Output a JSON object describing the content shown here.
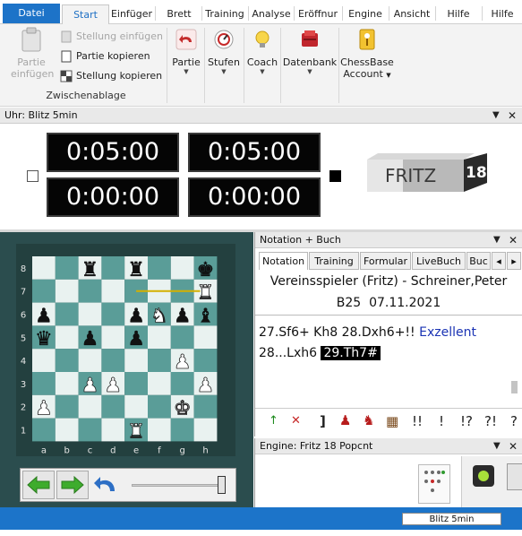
{
  "tabs": [
    "Datei",
    "Start",
    "Einfüger",
    "Brett",
    "Training",
    "Analyse",
    "Eröffnur",
    "Engine",
    "Ansicht",
    "Hilfe",
    "Hilfe"
  ],
  "ribbon": {
    "paste_label_1": "Partie",
    "paste_label_2": "einfügen",
    "insert_position": "Stellung einfügen",
    "copy_game": "Partie kopieren",
    "copy_position": "Stellung kopieren",
    "group_label": "Zwischenablage",
    "partie": "Partie",
    "stufen": "Stufen",
    "coach": "Coach",
    "datenbank": "Datenbank",
    "chessbase_1": "ChessBase",
    "chessbase_2": "Account"
  },
  "clock_panel": {
    "title": "Uhr: Blitz 5min",
    "times": [
      "0:05:00",
      "0:05:00",
      "0:00:00",
      "0:00:00"
    ],
    "logo_text": "FRITZ",
    "logo_number": "18"
  },
  "board": {
    "files": [
      "a",
      "b",
      "c",
      "d",
      "e",
      "f",
      "g",
      "h"
    ],
    "ranks": [
      "8",
      "7",
      "6",
      "5",
      "4",
      "3",
      "2",
      "1"
    ],
    "pieces": [
      {
        "sq": "c8",
        "p": "♜",
        "c": "b"
      },
      {
        "sq": "e8",
        "p": "♜",
        "c": "b"
      },
      {
        "sq": "h8",
        "p": "♚",
        "c": "b"
      },
      {
        "sq": "h7",
        "p": "♜",
        "c": "w"
      },
      {
        "sq": "a6",
        "p": "♟",
        "c": "b"
      },
      {
        "sq": "e6",
        "p": "♟",
        "c": "b"
      },
      {
        "sq": "f6",
        "p": "♞",
        "c": "w"
      },
      {
        "sq": "g6",
        "p": "♟",
        "c": "b"
      },
      {
        "sq": "h6",
        "p": "♝",
        "c": "b"
      },
      {
        "sq": "a5",
        "p": "♛",
        "c": "b"
      },
      {
        "sq": "c5",
        "p": "♟",
        "c": "b"
      },
      {
        "sq": "e5",
        "p": "♟",
        "c": "b"
      },
      {
        "sq": "g4",
        "p": "♟",
        "c": "w"
      },
      {
        "sq": "c3",
        "p": "♟",
        "c": "w"
      },
      {
        "sq": "d3",
        "p": "♟",
        "c": "w"
      },
      {
        "sq": "h3",
        "p": "♟",
        "c": "w"
      },
      {
        "sq": "a2",
        "p": "♟",
        "c": "w"
      },
      {
        "sq": "g2",
        "p": "♚",
        "c": "w"
      },
      {
        "sq": "e1",
        "p": "♜",
        "c": "w"
      }
    ],
    "last_move_from": "e7",
    "last_move_to": "h7"
  },
  "notation_panel": {
    "title": "Notation + Buch",
    "tabs": [
      "Notation",
      "Training",
      "Formular",
      "LiveBuch",
      "Buc"
    ],
    "players": "Vereinsspieler (Fritz) - Schreiner,Peter",
    "eco": "B25",
    "date": "07.11.2021",
    "line1_moves": "27.Sf6+  Kh8  28.Dxh6+!!",
    "line1_comment": "Exzellent",
    "line2_move": "28...Lxh6",
    "line2_current": "29.Th7#",
    "annotation_symbols": [
      "!!",
      "!",
      "!?",
      "?!",
      "?"
    ]
  },
  "engine_panel": {
    "title": "Engine: Fritz 18 Popcnt"
  },
  "status_bar": {
    "mode": "Blitz 5min"
  },
  "colors": {
    "accent": "#1d73c8",
    "board_light": "#e9f2f0",
    "board_dark": "#5a9d98",
    "board_frame": "#2b4d4e"
  }
}
